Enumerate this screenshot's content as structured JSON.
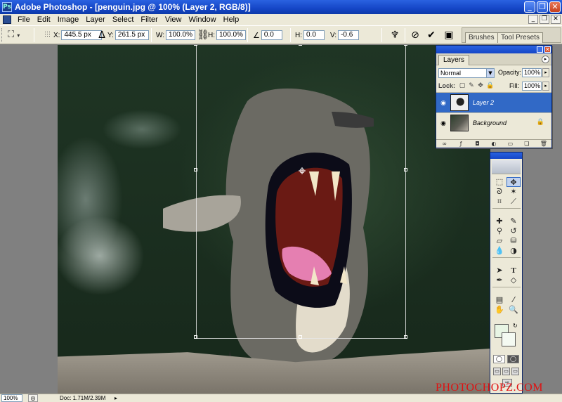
{
  "window": {
    "app_icon": "photoshop-icon",
    "title": "Adobe Photoshop - [penguin.jpg @ 100% (Layer 2, RGB/8)]",
    "buttons": {
      "minimize": "_",
      "maximize": "❐",
      "close": "✕"
    }
  },
  "menu": {
    "items": [
      "File",
      "Edit",
      "Image",
      "Layer",
      "Select",
      "Filter",
      "View",
      "Window",
      "Help"
    ],
    "doc_buttons": {
      "minimize": "_",
      "restore": "❐",
      "close": "✕"
    }
  },
  "options": {
    "x_label": "X:",
    "x_value": "445.5 px",
    "y_label": "Y:",
    "y_value": "261.5 px",
    "w_label": "W:",
    "w_value": "100.0%",
    "h_label": "H:",
    "h_value": "100.0%",
    "rotate_value": "0.0",
    "hskew_label": "H:",
    "hskew_value": "0.0",
    "vskew_label": "V:",
    "vskew_value": "-0.6",
    "palette_well_tabs": [
      "Brushes",
      "Tool Presets"
    ]
  },
  "layers_palette": {
    "tab": "Layers",
    "blend_mode": "Normal",
    "opacity_label": "Opacity:",
    "opacity_value": "100%",
    "fill_label": "Fill:",
    "fill_value": "100%",
    "lock_label": "Lock:",
    "layers": [
      {
        "name": "Layer 2",
        "visible": true,
        "active": true,
        "locked": false
      },
      {
        "name": "Background",
        "visible": true,
        "active": false,
        "locked": true
      }
    ]
  },
  "status": {
    "zoom": "100%",
    "doc": "Doc: 1.71M/2.39M"
  },
  "watermark": "PHOTOCHOPZ.COM",
  "colors": {
    "title_blue": "#1546c7",
    "chrome": "#ece9d8",
    "selection": "#3169c6",
    "foreground_swatch": "#e8f5e4",
    "watermark": "#e01010"
  }
}
